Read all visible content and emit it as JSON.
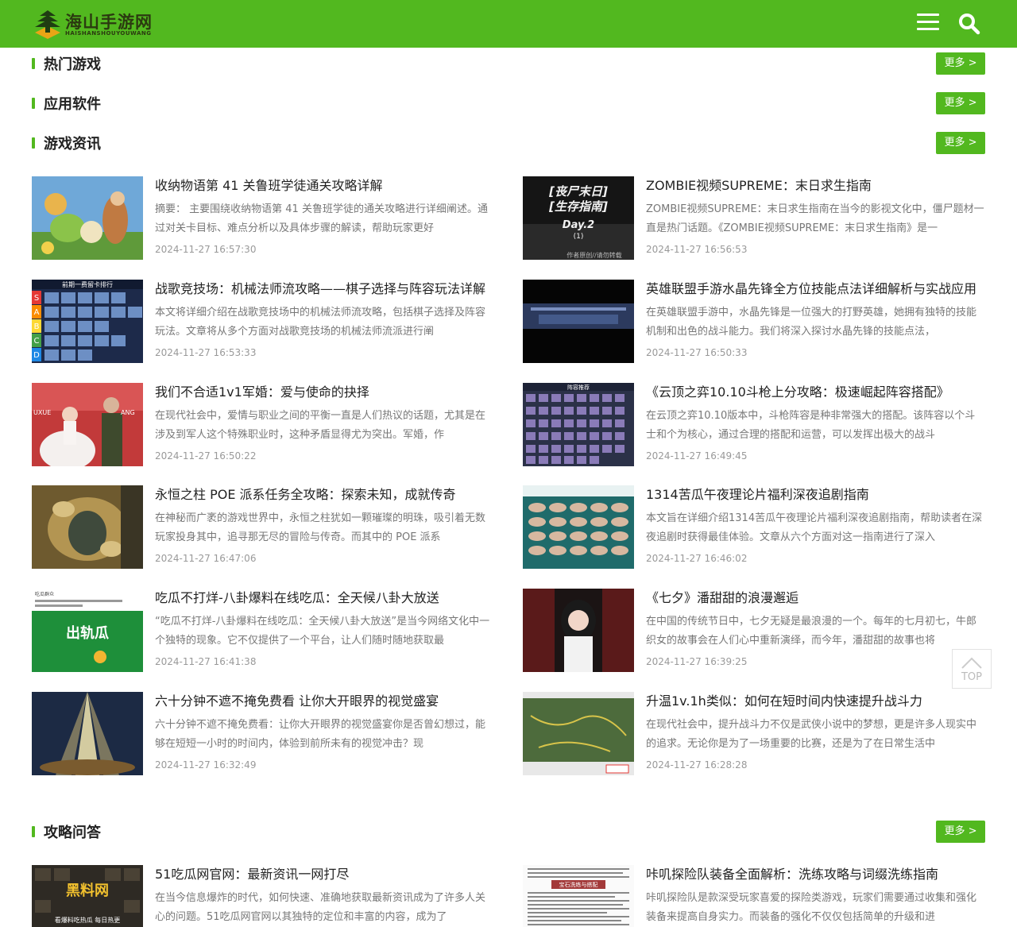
{
  "header": {
    "site_name": "海山手游网",
    "site_sub": "HAISHANSHOUYOUWANG",
    "brand_color": "#52b81f"
  },
  "sections": [
    {
      "title": "热门游戏",
      "more": "更多 >"
    },
    {
      "title": "应用软件",
      "more": "更多 >"
    },
    {
      "title": "游戏资讯",
      "more": "更多 >"
    },
    {
      "title": "攻略问答",
      "more": "更多 >"
    }
  ],
  "news": [
    {
      "title": "收纳物语第 41 关鲁班学徒通关攻略详解",
      "desc": "摘要： 主要围绕收纳物语第 41 关鲁班学徒的通关攻略进行详细阐述。通过对关卡目标、难点分析以及具体步骤的解读，帮助玩家更好",
      "date": "2024-11-27 16:57:30"
    },
    {
      "title": "ZOMBIE视频SUPREME：末日求生指南",
      "desc": "ZOMBIE视频SUPREME：末日求生指南在当今的影视文化中，僵尸题材一直是热门话题。《ZOMBIE视频SUPREME：末日求生指南》是一",
      "date": "2024-11-27 16:56:53"
    },
    {
      "title": "战歌竞技场：机械法师流攻略——棋子选择与阵容玩法详解",
      "desc": "本文将详细介绍在战歌竞技场中的机械法师流攻略，包括棋子选择及阵容玩法。文章将从多个方面对战歌竞技场的机械法师流派进行阐",
      "date": "2024-11-27 16:53:33"
    },
    {
      "title": "英雄联盟手游水晶先锋全方位技能点法详细解析与实战应用",
      "desc": "在英雄联盟手游中，水晶先锋是一位强大的打野英雄，她拥有独特的技能机制和出色的战斗能力。我们将深入探讨水晶先锋的技能点法，",
      "date": "2024-11-27 16:50:33"
    },
    {
      "title": "我们不合适1v1军婚：爱与使命的抉择",
      "desc": "在现代社会中，爱情与职业之间的平衡一直是人们热议的话题，尤其是在涉及到军人这个特殊职业时，这种矛盾显得尤为突出。军婚，作",
      "date": "2024-11-27 16:50:22"
    },
    {
      "title": "《云顶之弈10.10斗枪上分攻略：极速崛起阵容搭配》",
      "desc": "在云顶之弈10.10版本中，斗枪阵容是种非常强大的搭配。该阵容以个斗士和个为核心，通过合理的搭配和运营，可以发挥出极大的战斗",
      "date": "2024-11-27 16:49:45"
    },
    {
      "title": "永恒之柱 POE 派系任务全攻略：探索未知，成就传奇",
      "desc": "在神秘而广袤的游戏世界中，永恒之柱犹如一颗璀璨的明珠，吸引着无数玩家投身其中，追寻那无尽的冒险与传奇。而其中的 POE 派系",
      "date": "2024-11-27 16:47:06"
    },
    {
      "title": "1314苦瓜午夜理论片福利深夜追剧指南",
      "desc": "本文旨在详细介绍1314苦瓜午夜理论片福利深夜追剧指南，帮助读者在深夜追剧时获得最佳体验。文章从六个方面对这一指南进行了深入",
      "date": "2024-11-27 16:46:02"
    },
    {
      "title": "吃瓜不打烊-八卦爆料在线吃瓜：全天候八卦大放送",
      "desc": "“吃瓜不打烊-八卦爆料在线吃瓜：全天候八卦大放送”是当今网络文化中一个独特的现象。它不仅提供了一个平台，让人们随时随地获取最",
      "date": "2024-11-27 16:41:38"
    },
    {
      "title": "《七夕》潘甜甜的浪漫邂逅",
      "desc": "在中国的传统节日中，七夕无疑是最浪漫的一个。每年的七月初七，牛郎织女的故事会在人们心中重新演绎，而今年，潘甜甜的故事也将",
      "date": "2024-11-27 16:39:25"
    },
    {
      "title": "六十分钟不遮不掩免费看 让你大开眼界的视觉盛宴",
      "desc": "六十分钟不遮不掩免费看：让你大开眼界的视觉盛宴你是否曾幻想过，能够在短短一小时的时间内，体验到前所未有的视觉冲击？现",
      "date": "2024-11-27 16:32:49"
    },
    {
      "title": "升温1v.1h类似：如何在短时间内快速提升战斗力",
      "desc": "在现代社会中，提升战斗力不仅是武侠小说中的梦想，更是许多人现实中的追求。无论你是为了一场重要的比赛，还是为了在日常生活中",
      "date": "2024-11-27 16:28:28"
    }
  ],
  "qa": [
    {
      "title": "51吃瓜网官网：最新资讯一网打尽",
      "desc": "在当今信息爆炸的时代，如何快速、准确地获取最新资讯成为了许多人关心的问题。51吃瓜网官网以其独特的定位和丰富的内容，成为了"
    },
    {
      "title": "咔叽探险队装备全面解析：洗练攻略与词缀洗练指南",
      "desc": "咔叽探险队是款深受玩家喜爱的探险类游戏，玩家们需要通过收集和强化装备来提高自身实力。而装备的强化不仅仅包括简单的升级和进"
    }
  ],
  "thumb_text": {
    "t1_line1": "[丧尸末日]",
    "t1_line2": "[生存指南]",
    "t1_line3": "Day.2",
    "t1_line4": "(1)",
    "t1_footer": "作者原创//请勿转载",
    "t2_header": "前期一费留卡排行",
    "t2_tiers": [
      "S",
      "A",
      "B",
      "C",
      "D"
    ],
    "t3_left": "UXUE",
    "t3_right": "ANG",
    "t4_header": "阵容推荐",
    "t5_top": "吃瓜群众",
    "t5_main": "出轨瓜",
    "t6_main": "黑料网",
    "t6_sub": "看爆料吃热瓜 每日热更",
    "t7_header": "宝石洗练与搭配"
  },
  "back_to_top": "TOP"
}
